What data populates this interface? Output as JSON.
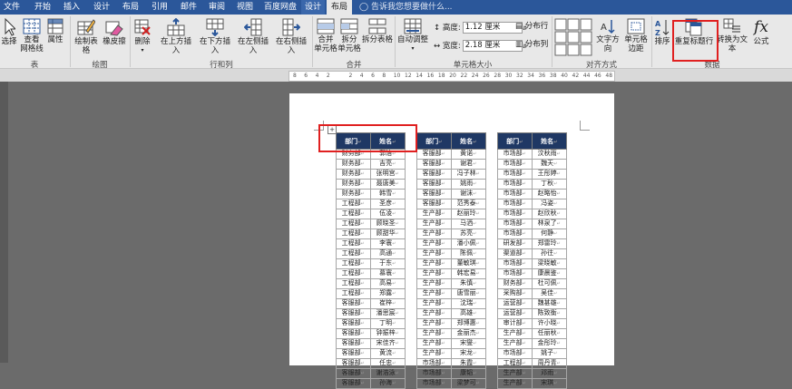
{
  "tabs": [
    {
      "label": "文件",
      "active": false,
      "ctx": false
    },
    {
      "label": "开始",
      "active": false,
      "ctx": false
    },
    {
      "label": "插入",
      "active": false,
      "ctx": false
    },
    {
      "label": "设计",
      "active": false,
      "ctx": false
    },
    {
      "label": "布局",
      "active": false,
      "ctx": false
    },
    {
      "label": "引用",
      "active": false,
      "ctx": false
    },
    {
      "label": "邮件",
      "active": false,
      "ctx": false
    },
    {
      "label": "审阅",
      "active": false,
      "ctx": false
    },
    {
      "label": "视图",
      "active": false,
      "ctx": false
    },
    {
      "label": "百度网盘",
      "active": false,
      "ctx": false
    },
    {
      "label": "设计",
      "active": false,
      "ctx": true
    },
    {
      "label": "布局",
      "active": true,
      "ctx": true
    }
  ],
  "tell_me": "告诉我您想要做什么...",
  "groups": {
    "table": "表",
    "draw": "绘图",
    "rows_cols": "行和列",
    "merge": "合并",
    "cell_size": "单元格大小",
    "align": "对齐方式",
    "data": "数据"
  },
  "buttons": {
    "select": "选择",
    "gridlines_1": "查看",
    "gridlines_2": "网格线",
    "properties": "属性",
    "draw_table": "绘制表格",
    "eraser": "橡皮擦",
    "delete": "删除",
    "insert_above": "在上方插入",
    "insert_below": "在下方插入",
    "insert_left": "在左侧插入",
    "insert_right": "在右侧插入",
    "merge_1": "合并",
    "merge_2": "单元格",
    "split_cells_1": "拆分",
    "split_cells_2": "单元格",
    "split_table": "拆分表格",
    "autofit": "自动调整",
    "text_direction": "文字方向",
    "cell_margins_1": "单元格",
    "cell_margins_2": "边距",
    "sort": "排序",
    "repeat_header": "重复标题行",
    "convert_text": "转换为文本",
    "formula": "公式"
  },
  "cell_size": {
    "height_label": "高度:",
    "height_value": "1.12 厘米",
    "width_label": "宽度:",
    "width_value": "2.18 厘米",
    "distribute_rows": "分布行",
    "distribute_cols": "分布列"
  },
  "ruler": {
    "numbers": [
      "8",
      "6",
      "4",
      "2",
      "",
      "2",
      "4",
      "6",
      "8",
      "10",
      "12",
      "14",
      "16",
      "18",
      "20",
      "22",
      "24",
      "26",
      "28",
      "30",
      "32",
      "34",
      "36",
      "38",
      "40",
      "42",
      "44",
      "46",
      "48"
    ]
  },
  "header_dept": "部门",
  "header_name": "姓名",
  "table1": [
    [
      "财务部",
      "郭洁"
    ],
    [
      "财务部",
      "吉亮"
    ],
    [
      "财务部",
      "张明宫"
    ],
    [
      "财务部",
      "聂唐美"
    ],
    [
      "财务部",
      "韩雪"
    ],
    [
      "工程部",
      "圣彦"
    ],
    [
      "工程部",
      "伍凌"
    ],
    [
      "工程部",
      "顾晓圣"
    ],
    [
      "工程部",
      "顾甜华"
    ],
    [
      "工程部",
      "李寰"
    ],
    [
      "工程部",
      "高通"
    ],
    [
      "工程部",
      "于东"
    ],
    [
      "工程部",
      "慕寰"
    ],
    [
      "工程部",
      "高易"
    ],
    [
      "工程部",
      "郑露"
    ],
    [
      "客服部",
      "崔梓"
    ],
    [
      "客服部",
      "潘思宸"
    ],
    [
      "客服部",
      "丁明"
    ],
    [
      "客服部",
      "钟振梓"
    ],
    [
      "客服部",
      "宋佳齐"
    ],
    [
      "客服部",
      "黄流"
    ],
    [
      "客服部",
      "任忠"
    ],
    [
      "客服部",
      "谢浩泳"
    ],
    [
      "客服部",
      "孙海"
    ]
  ],
  "table2": [
    [
      "客服部",
      "黄诺"
    ],
    [
      "客服部",
      "谢君"
    ],
    [
      "客服部",
      "冯子林"
    ],
    [
      "客服部",
      "姚雨"
    ],
    [
      "客服部",
      "谢沫"
    ],
    [
      "客服部",
      "范秀泰"
    ],
    [
      "生产部",
      "赵丽玲"
    ],
    [
      "生产部",
      "马洒"
    ],
    [
      "生产部",
      "苏亮"
    ],
    [
      "生产部",
      "潘小佩"
    ],
    [
      "生产部",
      "陈佩"
    ],
    [
      "生产部",
      "董敏琪"
    ],
    [
      "生产部",
      "韩宏易"
    ],
    [
      "生产部",
      "朱慎"
    ],
    [
      "生产部",
      "唐雪丽"
    ],
    [
      "生产部",
      "沈瑞"
    ],
    [
      "生产部",
      "高雄"
    ],
    [
      "生产部",
      "郑博惠"
    ],
    [
      "生产部",
      "金丽杰"
    ],
    [
      "生产部",
      "宋燮"
    ],
    [
      "生产部",
      "宋龙"
    ],
    [
      "市场部",
      "朱霞"
    ],
    [
      "市场部",
      "康韬"
    ],
    [
      "市场部",
      "梁梦可"
    ]
  ],
  "table3": [
    [
      "市场部",
      "汶秋雨"
    ],
    [
      "市场部",
      "魏天"
    ],
    [
      "市场部",
      "王彤婷"
    ],
    [
      "市场部",
      "丁秋"
    ],
    [
      "市场部",
      "赵略怡"
    ],
    [
      "市场部",
      "冯姿"
    ],
    [
      "市场部",
      "赵欣秋"
    ],
    [
      "市场部",
      "林泉了"
    ],
    [
      "市场部",
      "何静"
    ],
    [
      "研发部",
      "郑雷玲"
    ],
    [
      "渠道部",
      "孙往"
    ],
    [
      "市场部",
      "梁晓敏"
    ],
    [
      "市场部",
      "康晨鉴"
    ],
    [
      "财务部",
      "杜可佩"
    ],
    [
      "采购部",
      "吴佳"
    ],
    [
      "运营部",
      "魏甚雄"
    ],
    [
      "运营部",
      "陈致衡"
    ],
    [
      "审计部",
      "许小晓"
    ],
    [
      "生产部",
      "任丽秋"
    ],
    [
      "生产部",
      "金彤玲"
    ],
    [
      "市场部",
      "姚子"
    ],
    [
      "工程部",
      "周丹青"
    ],
    [
      "生产部",
      "邓雨"
    ],
    [
      "生产部",
      "宋琪"
    ]
  ],
  "colors": {
    "tab_bar": "#2b579a",
    "ribbon": "#e8e8e8",
    "header_fill": "#1f3864",
    "highlight": "#e02020"
  }
}
